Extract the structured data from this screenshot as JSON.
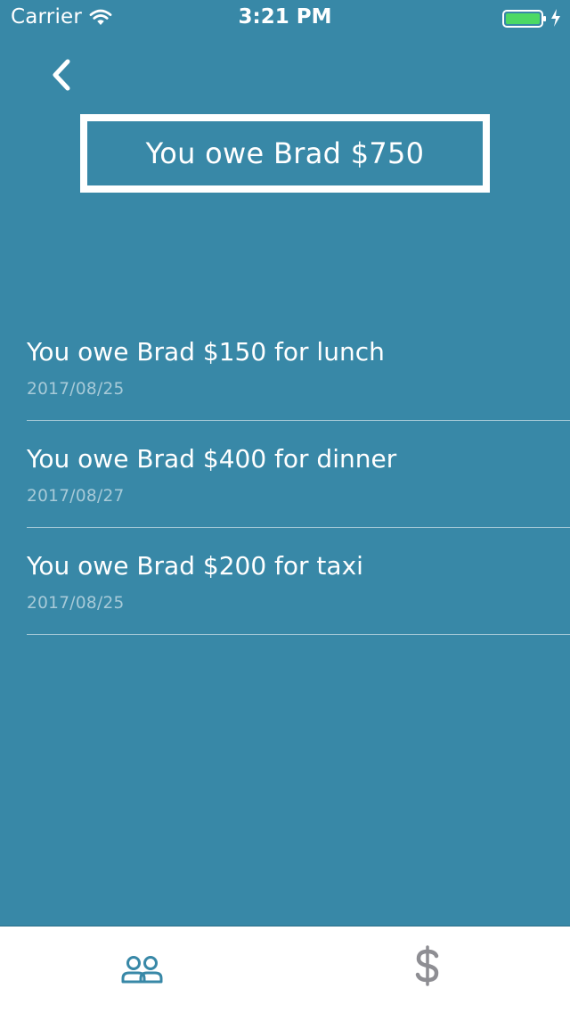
{
  "status_bar": {
    "carrier": "Carrier",
    "time": "3:21 PM",
    "icons": [
      "wifi-icon",
      "battery-icon",
      "charging-icon"
    ]
  },
  "header": {
    "back_icon": "chevron-left-icon",
    "total_label": "You owe Brad $750"
  },
  "debts": [
    {
      "title": "You owe Brad $150 for lunch",
      "date": "2017/08/25"
    },
    {
      "title": "You owe Brad $400 for dinner",
      "date": "2017/08/27"
    },
    {
      "title": "You owe Brad $200 for taxi",
      "date": "2017/08/25"
    }
  ],
  "tab_bar": {
    "tabs": [
      {
        "icon": "people-icon",
        "active": true
      },
      {
        "icon": "dollar-icon",
        "active": false
      }
    ]
  },
  "colors": {
    "background": "#3888a7",
    "text": "#ffffff",
    "date_text": "#a7cad8",
    "tab_active": "#3888a7",
    "tab_inactive": "#8e8e93",
    "battery": "#4cd964"
  }
}
